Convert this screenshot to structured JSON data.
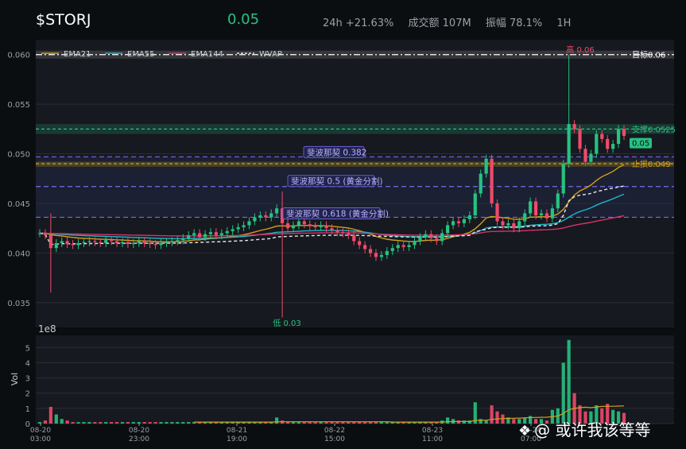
{
  "header": {
    "symbol": "$STORJ",
    "price": "0.05",
    "change": "24h +21.63%",
    "volume": "成交额 107M",
    "amplitude": "振幅 78.1%",
    "interval": "1H"
  },
  "watermark": {
    "text": "@ 或许我该等等",
    "icon": "wechat-like-icon"
  },
  "colors": {
    "up": "#26c281",
    "down": "#f04a6a",
    "ema21": "#d4a017",
    "ema55": "#1fb5c9",
    "ema144": "#d6336c",
    "wvap": "#e6e6e6",
    "fib": "#7b68ee",
    "support": "#26c281",
    "stop": "#d4a017"
  },
  "chart_data": {
    "type": "candlestick",
    "legend": [
      "EMA21",
      "EMA55",
      "EMA144",
      "WVAP"
    ],
    "price_axis": {
      "ticks": [
        "0.035",
        "0.040",
        "0.045",
        "0.050",
        "0.055",
        "0.060"
      ],
      "ylim": [
        0.0325,
        0.0615
      ]
    },
    "levels": [
      {
        "name": "目标",
        "label": "目标0.06",
        "value": 0.06,
        "kind": "target"
      },
      {
        "name": "支撑",
        "label": "支撑0.0525",
        "value": 0.0525,
        "kind": "support"
      },
      {
        "name": "止损",
        "label": "止损0.049",
        "value": 0.049,
        "kind": "stop"
      },
      {
        "name": "fib382",
        "label": "斐波那契 0.382",
        "value": 0.0497,
        "kind": "fib"
      },
      {
        "name": "fib5",
        "label": "斐波那契 0.5 (黄金分割)",
        "value": 0.0467,
        "kind": "fib"
      },
      {
        "name": "fib618",
        "label": "斐波那契 0.618 (黄金分割)",
        "value": 0.0436,
        "kind": "fib"
      }
    ],
    "high_label": "高 0.06",
    "low_label": "低 0.03",
    "last_price_label": "0.05",
    "volume_axis": {
      "ylabel": "Vol",
      "multiplier": "1e8",
      "ticks": [
        "0",
        "1",
        "2",
        "3",
        "4",
        "5"
      ],
      "ylim": [
        0,
        5.8
      ]
    },
    "time_ticks": [
      "08-20\n03:00",
      "08-20\n23:00",
      "08-21\n19:00",
      "08-22\n15:00",
      "08-23\n11:00",
      "08-24\n07:00"
    ],
    "close": [
      0.042,
      0.0418,
      0.0405,
      0.041,
      0.0412,
      0.0409,
      0.0408,
      0.041,
      0.0411,
      0.0412,
      0.0411,
      0.041,
      0.0413,
      0.0412,
      0.041,
      0.0411,
      0.0409,
      0.041,
      0.0412,
      0.041,
      0.0409,
      0.0408,
      0.041,
      0.0411,
      0.0412,
      0.0413,
      0.0415,
      0.0418,
      0.042,
      0.0416,
      0.0419,
      0.0421,
      0.0418,
      0.042,
      0.0422,
      0.0424,
      0.0426,
      0.0428,
      0.0432,
      0.0436,
      0.0438,
      0.0436,
      0.044,
      0.0445,
      0.043,
      0.0425,
      0.0428,
      0.0432,
      0.0429,
      0.0427,
      0.0426,
      0.0428,
      0.0425,
      0.0423,
      0.0421,
      0.042,
      0.0418,
      0.0412,
      0.0408,
      0.0404,
      0.04,
      0.0396,
      0.0398,
      0.0402,
      0.0405,
      0.0408,
      0.0406,
      0.0408,
      0.0412,
      0.0416,
      0.0419,
      0.0415,
      0.0412,
      0.042,
      0.0428,
      0.0432,
      0.043,
      0.0434,
      0.0438,
      0.046,
      0.048,
      0.0495,
      0.045,
      0.0432,
      0.0428,
      0.043,
      0.0425,
      0.0432,
      0.044,
      0.0452,
      0.0438,
      0.044,
      0.0435,
      0.0445,
      0.046,
      0.049,
      0.053,
      0.0525,
      0.0505,
      0.0492,
      0.05,
      0.052,
      0.0515,
      0.0505,
      0.051,
      0.0525,
      0.0518
    ],
    "volume": [
      0.1,
      0.2,
      1.1,
      0.6,
      0.3,
      0.2,
      0.1,
      0.1,
      0.1,
      0.1,
      0.1,
      0.1,
      0.1,
      0.1,
      0.1,
      0.1,
      0.1,
      0.1,
      0.1,
      0.1,
      0.1,
      0.1,
      0.1,
      0.1,
      0.1,
      0.1,
      0.1,
      0.1,
      0.1,
      0.1,
      0.1,
      0.1,
      0.1,
      0.1,
      0.1,
      0.1,
      0.1,
      0.1,
      0.1,
      0.1,
      0.1,
      0.1,
      0.1,
      0.4,
      0.2,
      0.1,
      0.1,
      0.1,
      0.1,
      0.1,
      0.1,
      0.1,
      0.1,
      0.1,
      0.1,
      0.1,
      0.1,
      0.1,
      0.1,
      0.1,
      0.1,
      0.1,
      0.1,
      0.1,
      0.1,
      0.1,
      0.1,
      0.1,
      0.1,
      0.1,
      0.1,
      0.1,
      0.1,
      0.2,
      0.4,
      0.3,
      0.2,
      0.2,
      0.2,
      1.4,
      0.3,
      0.2,
      1.2,
      0.8,
      0.6,
      0.4,
      0.3,
      0.3,
      0.4,
      0.5,
      0.3,
      0.3,
      0.2,
      0.9,
      1.0,
      4.0,
      5.5,
      2.0,
      1.2,
      0.8,
      0.8,
      1.2,
      1.0,
      1.3,
      0.9,
      0.8,
      0.7
    ]
  }
}
